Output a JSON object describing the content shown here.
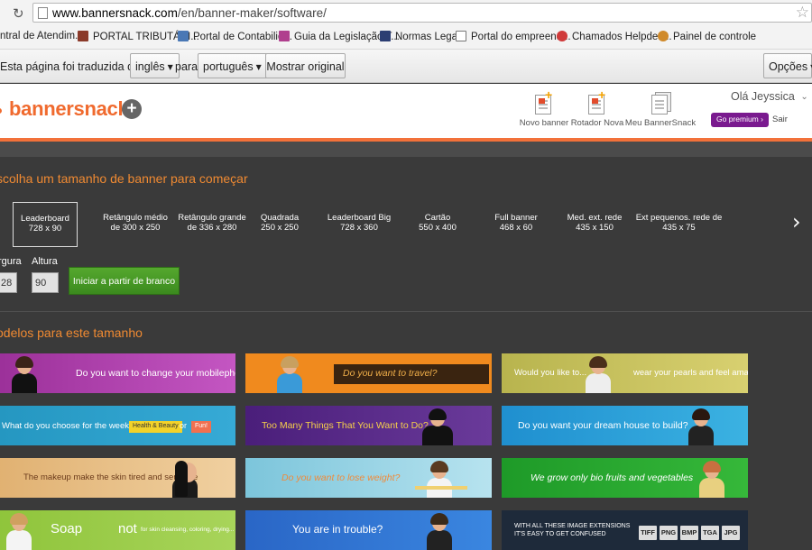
{
  "browser": {
    "url_domain": "www.bannersnack.com",
    "url_path": "/en/banner-maker/software/",
    "bookmarks": [
      {
        "label": "ntral de Atendim...",
        "color": "#6b7fa8"
      },
      {
        "label": "PORTAL TRIBUTÁRI...",
        "color": "#8b3a2a"
      },
      {
        "label": "Portal de Contabilid...",
        "color": "#4a78b5"
      },
      {
        "label": "Guia da Legislação T...",
        "color": "#b03f8e"
      },
      {
        "label": "Normas Legais",
        "color": "#2c3e73",
        "mark": "NL"
      },
      {
        "label": "Portal do empreend...",
        "color": "#ffffff",
        "mark": "E"
      },
      {
        "label": "Chamados Helpdes...",
        "color": "#d03a3a"
      },
      {
        "label": "Painel de controle",
        "color": "#d08a2a"
      }
    ],
    "translate_bar": {
      "text_before": "Esta página foi traduzida de",
      "from_lang": "inglês",
      "text_mid": "para",
      "to_lang": "português",
      "show_original": "Mostrar original",
      "options": "Opções"
    }
  },
  "header": {
    "logo": "bannersnack",
    "tools": [
      {
        "label": "Novo banner",
        "icon": "new-banner-icon"
      },
      {
        "label": "Rotador Nova",
        "icon": "rotator-icon"
      },
      {
        "label": "Meu BannerSnack",
        "icon": "my-bannersnack-icon"
      }
    ],
    "greeting": "Olá Jeyssica",
    "premium": "Go premium ›",
    "logout": "Sair",
    "accent": "#f2713a"
  },
  "size_section": {
    "title": "scolha um tamanho de banner para começar",
    "sizes": [
      {
        "name": "Leaderboard",
        "dims": "728 x 90",
        "selected": true
      },
      {
        "name": "Retângulo médio",
        "dims": "de 300 x 250"
      },
      {
        "name": "Retângulo grande",
        "dims": "de 336 x 280"
      },
      {
        "name": "Quadrada",
        "dims": "250 x 250"
      },
      {
        "name": "Leaderboard Big",
        "dims": "728 x 360"
      },
      {
        "name": "Cartão",
        "dims": "550 x 400"
      },
      {
        "name": "Full banner",
        "dims": "468 x 60"
      },
      {
        "name": "Med. ext. rede",
        "dims": "435 x 150"
      },
      {
        "name": "Ext pequenos. rede de",
        "dims": "435 x 75"
      }
    ],
    "width_label": "rgura",
    "width_value": "28",
    "height_label": "Altura",
    "height_value": "90",
    "start_button": "Iniciar a partir de branco"
  },
  "templates_section": {
    "title": "odelos para este tamanho",
    "banners": [
      {
        "text": "Do you want to change your mobilephone?",
        "bg": "#b23fb0"
      },
      {
        "text": "Do you want to travel?",
        "bg": "#f08a1e"
      },
      {
        "text": "Would you like to...",
        "text2": "wear your pearls and feel amazing?",
        "bg": "#c8c25a"
      },
      {
        "text": "What do you choose for the weekend?",
        "pill1": "Health & Beauty",
        "or": "or",
        "pill2": "Fun!",
        "bg": "#2a9fc6"
      },
      {
        "text": "Too Many Things That You Want to Do?",
        "bg": "#5a2a8a"
      },
      {
        "text": "Do you want your dream house to build?",
        "bg": "#2fa6d8"
      },
      {
        "text": "The makeup make the skin tired and sensitive",
        "bg": "#e8c080"
      },
      {
        "text": "Do you want to lose weight?",
        "bg": "#8fcde0"
      },
      {
        "text": "We grow only bio fruits and vegetables",
        "bg": "#3aa83a"
      },
      {
        "text": "Soap",
        "text2": "not",
        "text3": "for skin cleansing, coloring, drying...",
        "bg": "#9acd3e"
      },
      {
        "text": "You are in trouble?",
        "bg": "#2a6fd0"
      },
      {
        "text": "WITH ALL THESE IMAGE EXTENSIONS",
        "text2": "IT'S EASY TO GET CONFUSED",
        "formats": [
          "TIFF",
          "PNG",
          "BMP",
          "TGA",
          "JPG"
        ],
        "bg": "#1e2a3a"
      }
    ]
  }
}
